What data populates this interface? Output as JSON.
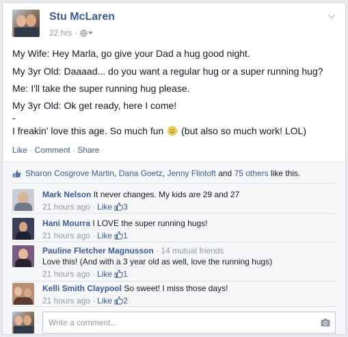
{
  "post": {
    "author": "Stu McLaren",
    "time": "22 hrs",
    "separator": "·",
    "privacy_icon": "globe-icon",
    "options_icon": "chevron-down-icon",
    "lines": [
      "My Wife: Hey Marla, go give your Dad a hug good night.",
      "My 3yr Old: Daaaad... do you want a regular hug or a super running hug?",
      "Me: I'll take the super running hug please.",
      "My 3yr Old: Ok get ready, here I come!",
      "-",
      "I freakin' love this age. So much fun",
      "(but also so much work! LOL)"
    ],
    "emoji_icon": "smiley-icon",
    "actions": [
      "Like",
      "Comment",
      "Share"
    ],
    "action_separator": " · "
  },
  "likes": {
    "icon": "thumbs-up-icon",
    "names": [
      "Sharon Cosgrove Martin",
      "Dana Goetz",
      "Jenny Flintoft"
    ],
    "comma": ",",
    "and": "and",
    "others": "75 others",
    "suffix": "like this."
  },
  "comments": [
    {
      "author": "Mark Nelson",
      "mutual": "",
      "text": "It never changes. My kids are 29 and 27",
      "time": "21 hours ago",
      "like_label": "Like",
      "like_count": "3"
    },
    {
      "author": "Hani Mourra",
      "mutual": "",
      "text": "I LOVE the super running hugs!",
      "time": "21 hours ago",
      "like_label": "Like",
      "like_count": "1"
    },
    {
      "author": "Pauline Fletcher Magnusson",
      "mutual": "· 14 mutual friends",
      "text": "Love this! (And with a 3 year old as well, love the running hugs)",
      "time": "21 hours ago",
      "like_label": "Like",
      "like_count": "1"
    },
    {
      "author": "Kelli Smith Claypool",
      "mutual": "",
      "text": "So sweet! I miss those days!",
      "time": "21 hours ago",
      "like_label": "Like",
      "like_count": "2"
    }
  ],
  "sub_separator": "·",
  "compose": {
    "placeholder": "Write a comment...",
    "camera_icon": "camera-icon"
  },
  "colors": {
    "link": "#3b5998",
    "meta": "#9197a3",
    "ufi_bg": "#f6f7f8",
    "page_bg": "#e9eaed"
  }
}
